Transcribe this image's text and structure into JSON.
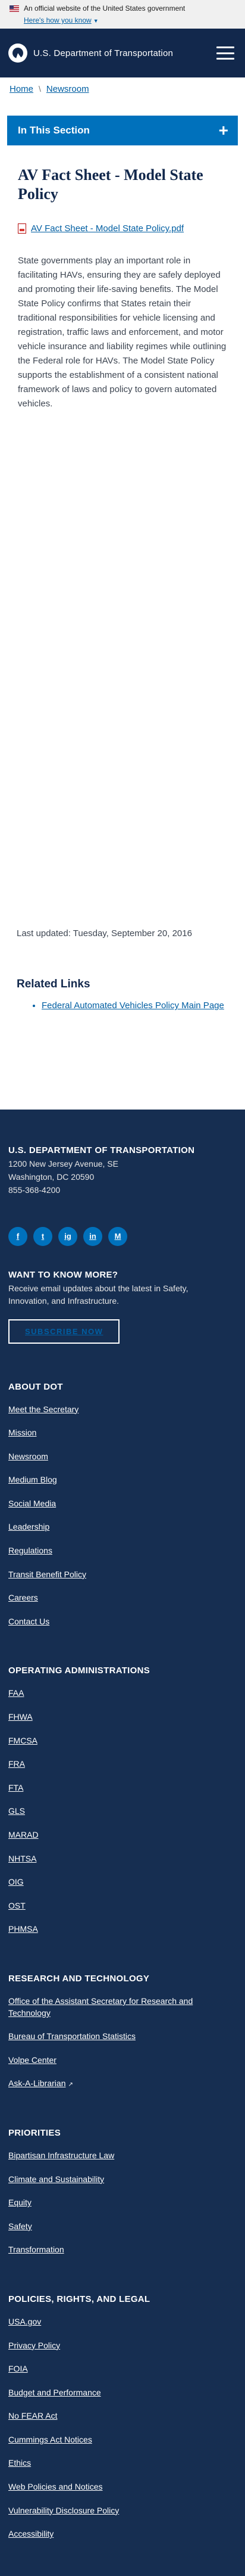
{
  "gov_banner": {
    "text": "An official website of the United States government",
    "link": "Here's how you know"
  },
  "header": {
    "logo_text": "U.S. Department of Transportation"
  },
  "breadcrumb": [
    "Home",
    "Newsroom"
  ],
  "section_nav": {
    "label": "In This Section"
  },
  "main": {
    "title": "AV Fact Sheet - Model State Policy",
    "pdf_link": "AV Fact Sheet - Model State Policy.pdf",
    "body": "State governments play an important role in facilitating HAVs, ensuring they are safely deployed and promoting their life-saving benefits. The Model State Policy confirms that States retain their traditional responsibilities for vehicle licensing and registration, traffic laws and enforcement, and motor vehicle insurance and liability regimes while outlining the Federal role for HAVs. The Model State Policy supports the establishment of a consistent national framework of laws and policy to govern automated vehicles.",
    "last_updated": "Last updated: Tuesday, September 20, 2016",
    "related_title": "Related Links",
    "related_links": [
      "Federal Automated Vehicles Policy Main Page"
    ]
  },
  "footer": {
    "org": "U.S. DEPARTMENT OF TRANSPORTATION",
    "address1": "1200 New Jersey Avenue, SE",
    "address2": "Washington, DC 20590",
    "phone": "855-368-4200",
    "social": [
      "f",
      "t",
      "ig",
      "in",
      "M"
    ],
    "want_title": "WANT TO KNOW MORE?",
    "want_text": "Receive email updates about the latest in Safety, Innovation, and Infrastructure.",
    "subscribe": "SUBSCRIBE NOW",
    "about": {
      "title": "ABOUT DOT",
      "items": [
        "Meet the Secretary",
        "Mission",
        "Newsroom",
        "Medium Blog",
        "Social Media",
        "Leadership",
        "Regulations",
        "Transit Benefit Policy",
        "Careers",
        "Contact Us"
      ]
    },
    "operating": {
      "title": "OPERATING ADMINISTRATIONS",
      "items": [
        "FAA",
        "FHWA",
        "FMCSA",
        "FRA",
        "FTA",
        "GLS",
        "MARAD",
        "NHTSA",
        "OIG",
        "OST",
        "PHMSA"
      ]
    },
    "research": {
      "title": "RESEARCH AND TECHNOLOGY",
      "items": [
        "Office of the Assistant Secretary for Research and Technology",
        "Bureau of Transportation Statistics",
        "Volpe Center",
        "Ask-A-Librarian"
      ]
    },
    "priorities": {
      "title": "PRIORITIES",
      "items": [
        "Bipartisan Infrastructure Law",
        "Climate and Sustainability",
        "Equity",
        "Safety",
        "Transformation"
      ]
    },
    "policies": {
      "title": "POLICIES, RIGHTS, AND LEGAL",
      "items": [
        "USA.gov",
        "Privacy Policy",
        "FOIA",
        "Budget and Performance",
        "No FEAR Act",
        "Cummings Act Notices",
        "Ethics",
        "Web Policies and Notices",
        "Vulnerability Disclosure Policy",
        "Accessibility"
      ]
    }
  }
}
